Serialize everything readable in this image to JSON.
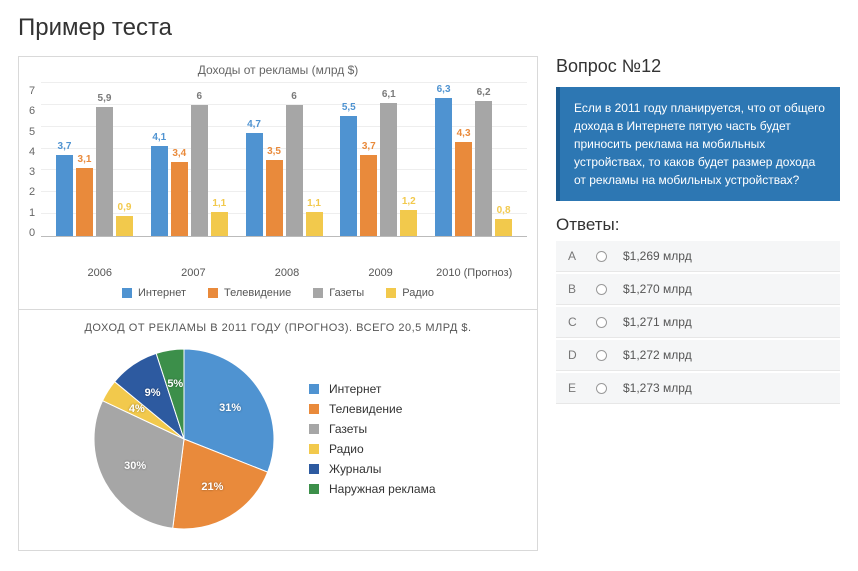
{
  "page_title": "Пример теста",
  "chart_data": [
    {
      "type": "bar",
      "title": "Доходы от рекламы (млрд $)",
      "categories": [
        "2006",
        "2007",
        "2008",
        "2009",
        "2010 (Прогноз)"
      ],
      "ylim": [
        0,
        7
      ],
      "yticks": [
        "0",
        "1",
        "2",
        "3",
        "4",
        "5",
        "6",
        "7"
      ],
      "series": [
        {
          "name": "Интернет",
          "color": "#4f93d1",
          "values": [
            3.7,
            4.1,
            4.7,
            5.5,
            6.3
          ]
        },
        {
          "name": "Телевидение",
          "color": "#e98a3b",
          "values": [
            3.1,
            3.4,
            3.5,
            3.7,
            4.3
          ]
        },
        {
          "name": "Газеты",
          "color": "#a6a6a6",
          "values": [
            5.9,
            6.0,
            6.0,
            6.1,
            6.2
          ]
        },
        {
          "name": "Радио",
          "color": "#f2c94c",
          "values": [
            0.9,
            1.1,
            1.1,
            1.2,
            0.8
          ]
        }
      ]
    },
    {
      "type": "pie",
      "title": "ДОХОД ОТ РЕКЛАМЫ В 2011 ГОДУ (ПРОГНОЗ). ВСЕГО 20,5 МЛРД $.",
      "series": [
        {
          "name": "Интернет",
          "color": "#4f93d1",
          "pct": 31,
          "label": "31%"
        },
        {
          "name": "Телевидение",
          "color": "#e98a3b",
          "pct": 21,
          "label": "21%"
        },
        {
          "name": "Газеты",
          "color": "#a6a6a6",
          "pct": 30,
          "label": "30%"
        },
        {
          "name": "Радио",
          "color": "#f2c94c",
          "pct": 4,
          "label": "4%"
        },
        {
          "name": "Журналы",
          "color": "#2d5aa0",
          "pct": 9,
          "label": "9%"
        },
        {
          "name": "Наружная реклама",
          "color": "#3c8f4a",
          "pct": 5,
          "label": "5%"
        }
      ]
    }
  ],
  "question": {
    "heading": "Вопрос №12",
    "text": "Если в 2011 году планируется, что от общего дохода в Интернете пятую часть будет приносить реклама на мобильных устройствах, то каков будет размер дохода от рекламы на мобильных устройствах?",
    "answers_heading": "Ответы:",
    "options": [
      {
        "letter": "A",
        "label": "$1,269 млрд"
      },
      {
        "letter": "B",
        "label": "$1,270 млрд"
      },
      {
        "letter": "C",
        "label": "$1,271 млрд"
      },
      {
        "letter": "D",
        "label": "$1,272 млрд"
      },
      {
        "letter": "E",
        "label": "$1,273 млрд"
      }
    ]
  }
}
